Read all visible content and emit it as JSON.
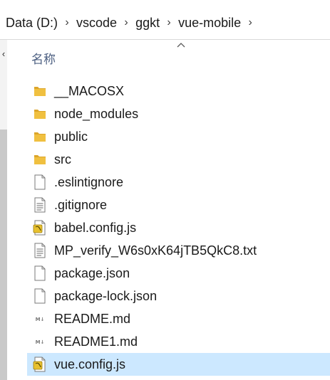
{
  "breadcrumb": {
    "items": [
      "Data (D:)",
      "vscode",
      "ggkt",
      "vue-mobile"
    ],
    "separator": "›"
  },
  "columns": {
    "name_header": "名称"
  },
  "files": [
    {
      "name": "__MACOSX",
      "icon": "folder-icon",
      "selected": false
    },
    {
      "name": "node_modules",
      "icon": "folder-icon",
      "selected": false
    },
    {
      "name": "public",
      "icon": "folder-icon",
      "selected": false
    },
    {
      "name": "src",
      "icon": "folder-icon",
      "selected": false
    },
    {
      "name": ".eslintignore",
      "icon": "blank-file-icon",
      "selected": false
    },
    {
      "name": ".gitignore",
      "icon": "text-file-icon",
      "selected": false
    },
    {
      "name": "babel.config.js",
      "icon": "js-file-icon",
      "selected": false
    },
    {
      "name": "MP_verify_W6s0xK64jTB5QkC8.txt",
      "icon": "text-file-icon",
      "selected": false
    },
    {
      "name": "package.json",
      "icon": "blank-file-icon",
      "selected": false
    },
    {
      "name": "package-lock.json",
      "icon": "blank-file-icon",
      "selected": false
    },
    {
      "name": "README.md",
      "icon": "markdown-file-icon",
      "selected": false
    },
    {
      "name": "README1.md",
      "icon": "markdown-file-icon",
      "selected": false
    },
    {
      "name": "vue.config.js",
      "icon": "js-file-icon",
      "selected": true
    }
  ],
  "colors": {
    "folder": "#f0c040",
    "folder_dark": "#dca52a",
    "selection": "#cce8ff",
    "header_text": "#4d6082",
    "js_badge": "#e8c12f"
  }
}
